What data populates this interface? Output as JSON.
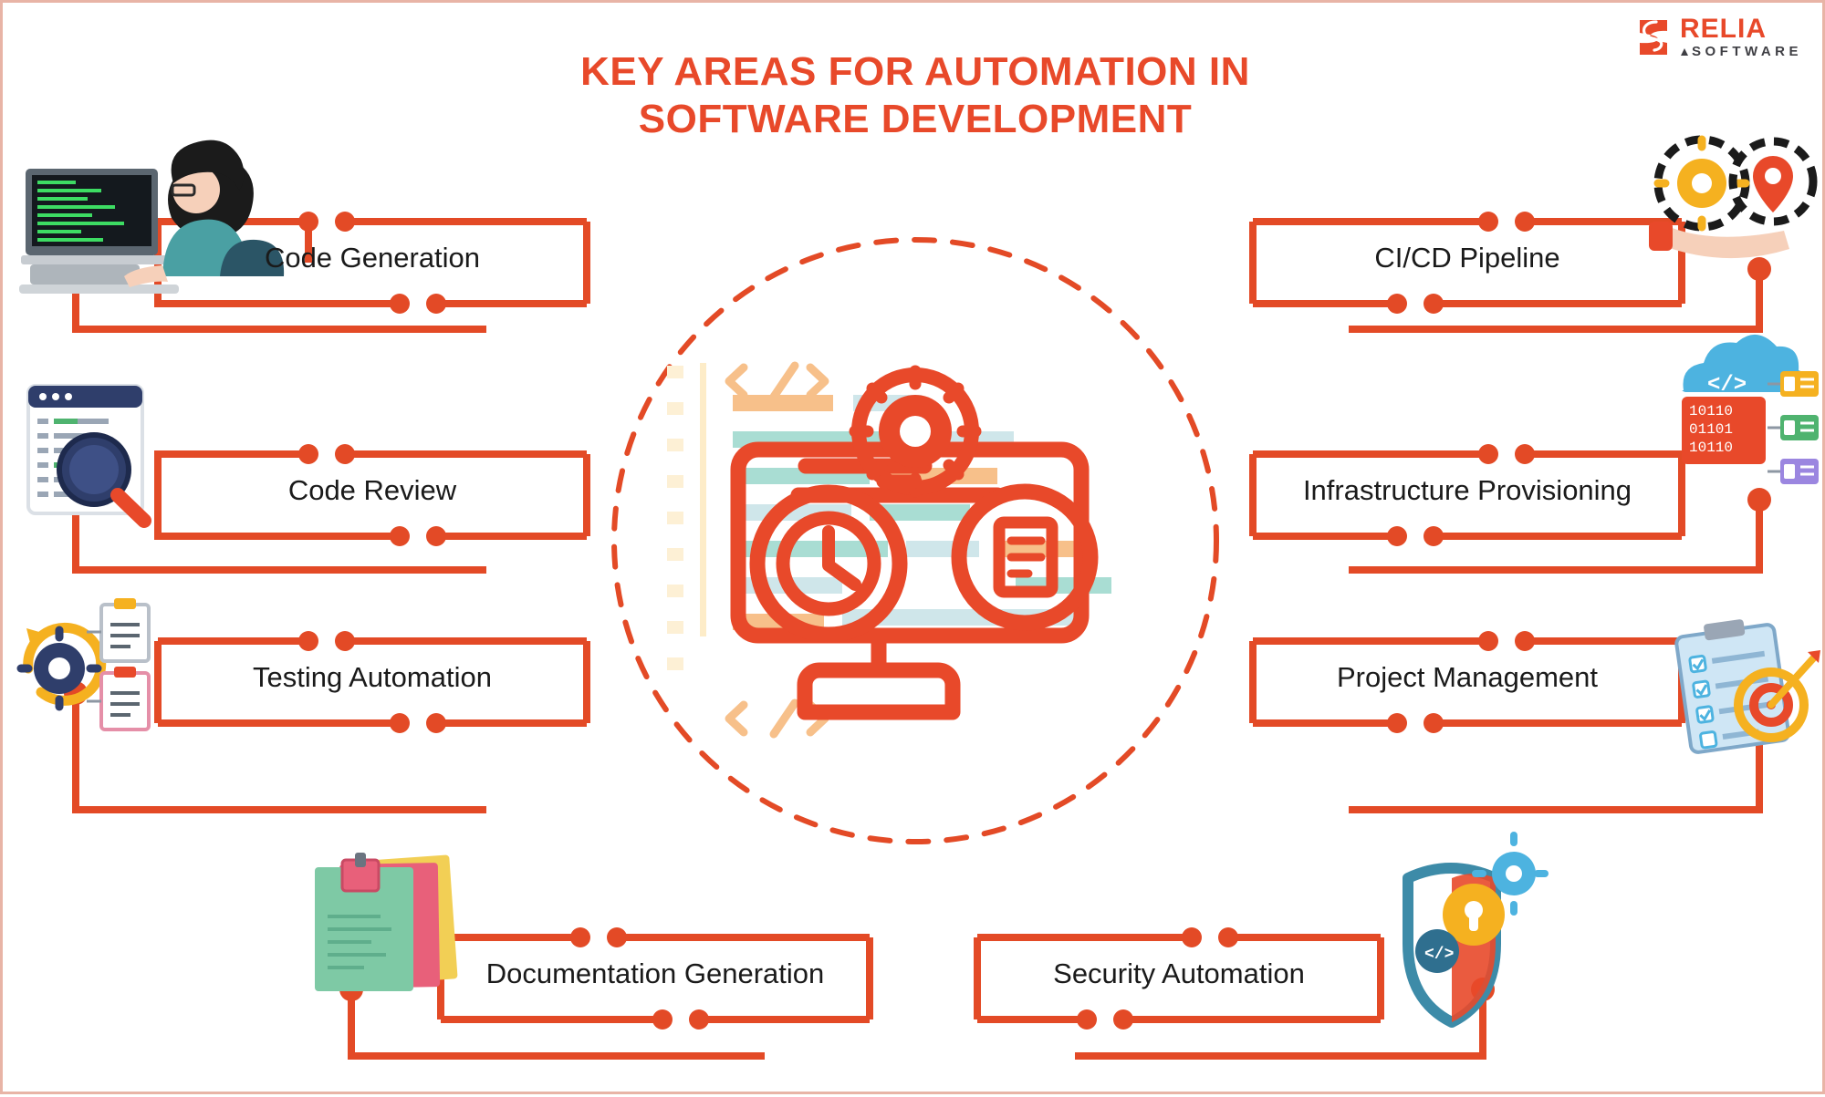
{
  "brand": {
    "name": "RELIA",
    "sub": "SOFTWARE",
    "accent": "#e8492a",
    "dark": "#3f3f44"
  },
  "header": {
    "title_line1": "KEY AREAS FOR AUTOMATION IN",
    "title_line2": "SOFTWARE DEVELOPMENT",
    "title_color": "#e8492a"
  },
  "colors": {
    "accent": "#e8492a",
    "line": "#e34a26",
    "text": "#1a1a1a",
    "border": "#e8b4a6",
    "code_orange": "#f7c08a",
    "code_teal": "#a9ddd3",
    "code_blue": "#cfe6ea",
    "code_cream": "#fdf0d5"
  },
  "center": {
    "icon_name": "automation-monitor-illustration",
    "dashed_circle": true,
    "glyphs": [
      "gear-icon",
      "clock-icon",
      "document-icon",
      "code-brackets-icon"
    ]
  },
  "nodes": {
    "left": [
      {
        "label": "Code Generation",
        "icon": "developer-at-computer-icon"
      },
      {
        "label": "Code Review",
        "icon": "code-review-magnifier-icon"
      },
      {
        "label": "Testing Automation",
        "icon": "testing-checklist-gear-icon"
      }
    ],
    "right": [
      {
        "label": "CI/CD Pipeline",
        "icon": "cicd-gear-pin-hand-icon"
      },
      {
        "label": "Infrastructure Provisioning",
        "icon": "cloud-infrastructure-icon"
      },
      {
        "label": "Project Management",
        "icon": "project-clipboard-target-icon"
      }
    ],
    "bottom": [
      {
        "label": "Documentation Generation",
        "icon": "documents-stack-icon"
      },
      {
        "label": "Security Automation",
        "icon": "security-shield-lock-icon"
      }
    ]
  }
}
